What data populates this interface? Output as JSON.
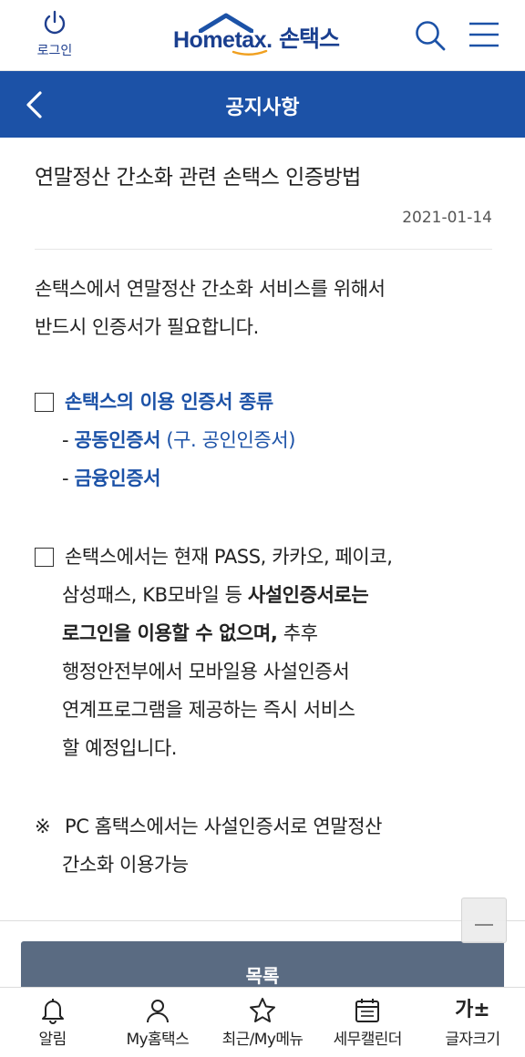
{
  "header": {
    "login_label": "로그인",
    "logo_brand": "Hometax.",
    "logo_sub": "손택스",
    "brand_color": "#1c52a7"
  },
  "titlebar": {
    "title": "공지사항"
  },
  "article": {
    "title": "연말정산 간소화 관련 손택스 인증방법",
    "date": "2021-01-14",
    "intro_lines": [
      "손택스에서 연말정산 간소화 서비스를 위해서",
      "반드시 인증서가 필요합니다."
    ],
    "section1": {
      "heading": "손택스의 이용 인증서 종류",
      "item1_prefix": "- ",
      "item1_name": "공동인증서",
      "item1_note": " (구. 공인인증서)",
      "item2_prefix": "- ",
      "item2_name": "금융인증서"
    },
    "section2": {
      "line1": "손택스에서는 현재 PASS, 카카오, 페이코,",
      "line2_plain": "삼성패스, KB모바일 등 ",
      "line2_bold": "사설인증서로는",
      "line3_bold": "로그인을 이용할 수 없으며,",
      "line3_plain": " 추후",
      "line4": "행정안전부에서 모바일용 사설인증서",
      "line5": "연계프로그램을 제공하는 즉시 서비스",
      "line6": "할 예정입니다."
    },
    "section3": {
      "mark": "※",
      "line1": "PC 홈택스에서는 사설인증서로 연말정산",
      "line2": "간소화 이용가능"
    }
  },
  "list_button": "목록",
  "bottom_nav": [
    {
      "icon": "bell-icon",
      "label": "알림"
    },
    {
      "icon": "person-icon",
      "label": "My홈택스"
    },
    {
      "icon": "star-icon",
      "label": "최근/My메뉴"
    },
    {
      "icon": "calendar-icon",
      "label": "세무캘린더"
    },
    {
      "icon": "font-size-icon",
      "label": "글자크기",
      "glyph": "가±"
    }
  ]
}
